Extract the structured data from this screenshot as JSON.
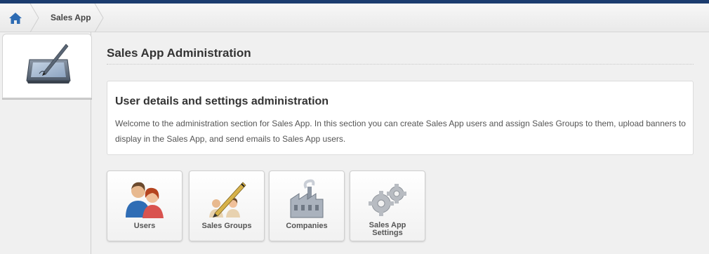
{
  "breadcrumb": {
    "home_icon": "home-icon",
    "items": [
      {
        "label": "Sales App"
      }
    ]
  },
  "sidebar": {
    "icon": "tablet-pen-icon"
  },
  "main": {
    "title": "Sales App Administration",
    "panel": {
      "title": "User details and settings administration",
      "text": "Welcome to the administration section for Sales App. In this section you can create Sales App users and assign Sales Groups to them, upload banners to display in the Sales App, and send emails to Sales App users."
    },
    "tiles": [
      {
        "label": "Users",
        "icon": "users-icon"
      },
      {
        "label": "Sales Groups",
        "icon": "sales-groups-icon"
      },
      {
        "label": "Companies",
        "icon": "factory-icon"
      },
      {
        "label_line1": "Sales App",
        "label_line2": "Settings",
        "icon": "gears-icon"
      }
    ]
  },
  "colors": {
    "topbar": "#1b3c6e",
    "home_icon": "#2d6bb3"
  }
}
